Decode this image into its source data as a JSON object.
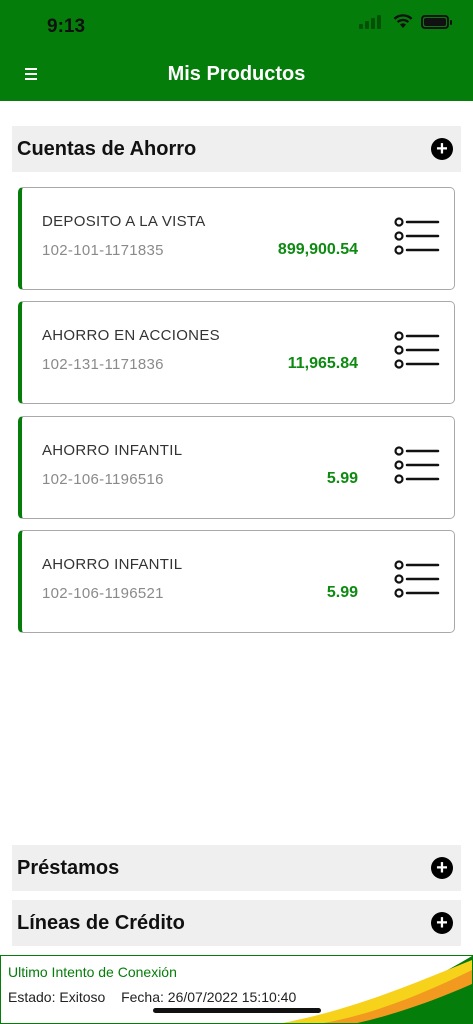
{
  "status_bar": {
    "time": "9:13"
  },
  "header": {
    "title": "Mis Productos"
  },
  "sections": {
    "savings": {
      "title": "Cuentas de Ahorro"
    },
    "loans": {
      "title": "Préstamos"
    },
    "credit": {
      "title": "Líneas de Crédito"
    }
  },
  "accounts": [
    {
      "name": "DEPOSITO A LA VISTA",
      "number": "102-101-1171835",
      "amount": "899,900.54"
    },
    {
      "name": "AHORRO EN ACCIONES",
      "number": "102-131-1171836",
      "amount": "11,965.84"
    },
    {
      "name": "AHORRO INFANTIL",
      "number": "102-106-1196516",
      "amount": "5.99"
    },
    {
      "name": "AHORRO INFANTIL",
      "number": "102-106-1196521",
      "amount": "5.99"
    }
  ],
  "footer": {
    "title": "Ultimo Intento de Conexión",
    "status_label": "Estado:",
    "status_value": "Exitoso",
    "date_label": "Fecha:",
    "date_value": "26/07/2022 15:10:40"
  },
  "colors": {
    "primary_green": "#057d0a",
    "amount_green": "#0d8a11",
    "accent_orange": "#f29a1f",
    "accent_yellow": "#f7d21a"
  },
  "icons": [
    "menu-icon",
    "wifi-icon",
    "battery-icon",
    "plus-icon",
    "list-icon"
  ]
}
